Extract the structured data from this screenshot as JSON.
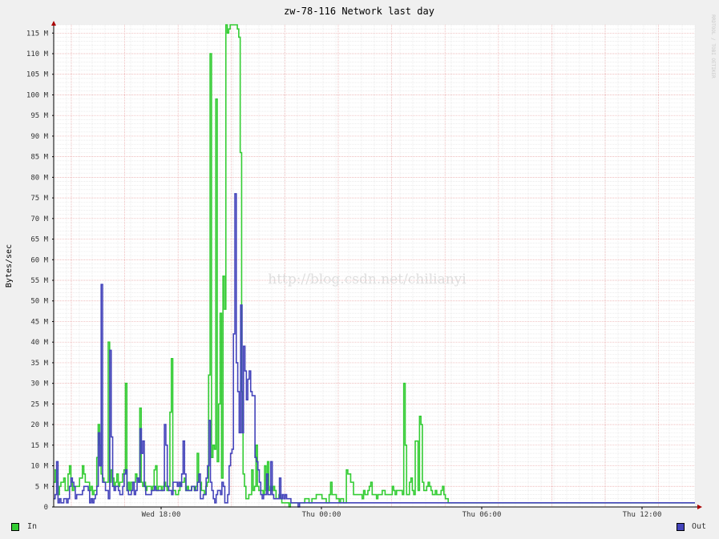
{
  "chart_data": {
    "type": "line",
    "title": "zw-78-116 Network last day",
    "ylabel": "Bytes/sec",
    "watermark": "http://blog.csdn.net/chilianyi",
    "vertical_label": "RRDTOOL / TOBI OETIKER",
    "ylim": [
      0,
      117
    ],
    "grid": true,
    "y_ticks": [
      {
        "value": 0,
        "label": "0"
      },
      {
        "value": 5,
        "label": "5 M"
      },
      {
        "value": 10,
        "label": "10 M"
      },
      {
        "value": 15,
        "label": "15 M"
      },
      {
        "value": 20,
        "label": "20 M"
      },
      {
        "value": 25,
        "label": "25 M"
      },
      {
        "value": 30,
        "label": "30 M"
      },
      {
        "value": 35,
        "label": "35 M"
      },
      {
        "value": 40,
        "label": "40 M"
      },
      {
        "value": 45,
        "label": "45 M"
      },
      {
        "value": 50,
        "label": "50 M"
      },
      {
        "value": 55,
        "label": "55 M"
      },
      {
        "value": 60,
        "label": "60 M"
      },
      {
        "value": 65,
        "label": "65 M"
      },
      {
        "value": 70,
        "label": "70 M"
      },
      {
        "value": 75,
        "label": "75 M"
      },
      {
        "value": 80,
        "label": "80 M"
      },
      {
        "value": 85,
        "label": "85 M"
      },
      {
        "value": 90,
        "label": "90 M"
      },
      {
        "value": 95,
        "label": "95 M"
      },
      {
        "value": 100,
        "label": "100 M"
      },
      {
        "value": 105,
        "label": "105 M"
      },
      {
        "value": 110,
        "label": "110 M"
      },
      {
        "value": 115,
        "label": "115 M"
      }
    ],
    "x_ticks": [
      {
        "x": 67,
        "label": "Wed 18:00"
      },
      {
        "x": 167,
        "label": "Thu 00:00"
      },
      {
        "x": 267,
        "label": "Thu 06:00"
      },
      {
        "x": 367,
        "label": "Thu 12:00"
      }
    ],
    "x_range": [
      0,
      400
    ],
    "series": [
      {
        "name": "In",
        "color": "#33cc33",
        "values": [
          6,
          9,
          6,
          3,
          5,
          6,
          6,
          7,
          4,
          4,
          8,
          10,
          6,
          4,
          5,
          5,
          5,
          5,
          7,
          7,
          10,
          8,
          6,
          6,
          6,
          4,
          5,
          3,
          4,
          4,
          12,
          20,
          15,
          8,
          7,
          6,
          6,
          6,
          40,
          6,
          9,
          7,
          5,
          6,
          8,
          5,
          6,
          6,
          8,
          9,
          30,
          4,
          6,
          4,
          6,
          6,
          6,
          8,
          7,
          6,
          24,
          6,
          5,
          6,
          4,
          5,
          5,
          5,
          4,
          5,
          9,
          10,
          4,
          5,
          5,
          4,
          5,
          6,
          5,
          4,
          5,
          23,
          36,
          4,
          4,
          3,
          3,
          4,
          5,
          6,
          6,
          7,
          4,
          5,
          4,
          4,
          5,
          5,
          4,
          5,
          13,
          6,
          6,
          4,
          4,
          3,
          5,
          6,
          32,
          110,
          12,
          15,
          14,
          99,
          11,
          25,
          47,
          7,
          56,
          48,
          117,
          115,
          116,
          117,
          117,
          117,
          117,
          117,
          116,
          114,
          86,
          28,
          8,
          5,
          2,
          2,
          3,
          3,
          9,
          4,
          5,
          15,
          5,
          4,
          4,
          4,
          3,
          10,
          4,
          11,
          4,
          5,
          4,
          5,
          4,
          2,
          2,
          3,
          2,
          1,
          1,
          1,
          1,
          1,
          0,
          1,
          1,
          1,
          1,
          1,
          1,
          1,
          1,
          1,
          1,
          2,
          2,
          2,
          1,
          1,
          2,
          2,
          2,
          3,
          3,
          3,
          3,
          2,
          2,
          2,
          1,
          1,
          3,
          6,
          3,
          3,
          3,
          2,
          2,
          1,
          2,
          2,
          1,
          1,
          9,
          8,
          8,
          6,
          6,
          3,
          3,
          3,
          3,
          3,
          3,
          2,
          4,
          3,
          3,
          4,
          5,
          6,
          3,
          3,
          3,
          2,
          3,
          3,
          3,
          4,
          4,
          3,
          3,
          3,
          3,
          3,
          5,
          4,
          3,
          4,
          4,
          4,
          4,
          3,
          30,
          15,
          3,
          3,
          6,
          7,
          4,
          3,
          16,
          16,
          4,
          22,
          20,
          6,
          4,
          4,
          5,
          6,
          5,
          4,
          3,
          3,
          4,
          3,
          3,
          3,
          4,
          5,
          3,
          2,
          2,
          1,
          1,
          1,
          1,
          1,
          1,
          1,
          1,
          1,
          1,
          1,
          1,
          1,
          1,
          1,
          1,
          1,
          1,
          1,
          1,
          1,
          1,
          1,
          1,
          1,
          1,
          1,
          1,
          1,
          1,
          1,
          1,
          1,
          1,
          1,
          1,
          1,
          1,
          1,
          1,
          1,
          1,
          1,
          1,
          1,
          1,
          1,
          1,
          1,
          1,
          1,
          1,
          1,
          1,
          1,
          1,
          1,
          1,
          1,
          1,
          1,
          1,
          1,
          1,
          1,
          1,
          1,
          1,
          1,
          1,
          1,
          1,
          1,
          1,
          1,
          1,
          1,
          1,
          1,
          1,
          1,
          1,
          1,
          1,
          1,
          1,
          1,
          1,
          1,
          1,
          1,
          1,
          1,
          1,
          1,
          1,
          1,
          1,
          1,
          1,
          1,
          1,
          1,
          1,
          1,
          1,
          1,
          1,
          1,
          1,
          1,
          1,
          1,
          1,
          1,
          1,
          1,
          1,
          1,
          1,
          1,
          1,
          1,
          1,
          1,
          1,
          1,
          1,
          1,
          1,
          1,
          1,
          1,
          1,
          1,
          1,
          1,
          1,
          1,
          1,
          1,
          1,
          1,
          1,
          1,
          1,
          1,
          1,
          1,
          1,
          1,
          1,
          1,
          1,
          1,
          1,
          1,
          1,
          1,
          1,
          1,
          1,
          1,
          1,
          1,
          1,
          1,
          1,
          1,
          1,
          1,
          1
        ]
      },
      {
        "name": "Out",
        "color": "#4444bb",
        "values": [
          2,
          3,
          11,
          1,
          2,
          1,
          1,
          2,
          2,
          1,
          2,
          5,
          7,
          6,
          5,
          2,
          3,
          3,
          3,
          3,
          4,
          5,
          5,
          5,
          4,
          1,
          2,
          1,
          2,
          3,
          5,
          18,
          10,
          54,
          6,
          6,
          4,
          4,
          2,
          38,
          17,
          5,
          4,
          5,
          5,
          4,
          3,
          3,
          5,
          8,
          9,
          4,
          3,
          3,
          4,
          6,
          3,
          4,
          7,
          6,
          19,
          13,
          16,
          5,
          3,
          3,
          3,
          3,
          4,
          4,
          5,
          4,
          4,
          4,
          4,
          4,
          4,
          20,
          15,
          5,
          4,
          4,
          3,
          6,
          6,
          6,
          5,
          6,
          5,
          8,
          16,
          8,
          4,
          4,
          4,
          4,
          5,
          5,
          4,
          4,
          6,
          8,
          2,
          2,
          3,
          3,
          7,
          10,
          21,
          6,
          4,
          2,
          1,
          3,
          4,
          4,
          3,
          6,
          5,
          1,
          1,
          3,
          10,
          13,
          14,
          42,
          76,
          35,
          28,
          18,
          49,
          18,
          39,
          33,
          26,
          31,
          33,
          28,
          27,
          27,
          12,
          11,
          9,
          6,
          3,
          2,
          3,
          3,
          8,
          3,
          3,
          11,
          3,
          2,
          2,
          2,
          2,
          7,
          2,
          3,
          2,
          3,
          2,
          2,
          2,
          1,
          1,
          1,
          1,
          1,
          0,
          1,
          1,
          1,
          1,
          1,
          1,
          1,
          1,
          1,
          1,
          1,
          1,
          1,
          1,
          1,
          1,
          1,
          1,
          1,
          1,
          1,
          1,
          1,
          1,
          1,
          1,
          1,
          1,
          1,
          1,
          1,
          1,
          1,
          1,
          1,
          1,
          1,
          1,
          1,
          1,
          1,
          1,
          1,
          1,
          1,
          1,
          1,
          1,
          1,
          1,
          1,
          1,
          1,
          1,
          1,
          1,
          1,
          1,
          1,
          1,
          1,
          1,
          1,
          1,
          1,
          1,
          1,
          1,
          1,
          1,
          1,
          1,
          1,
          1,
          1,
          1,
          1,
          1,
          1,
          1,
          1,
          1,
          1,
          1,
          1,
          1,
          1,
          1,
          1,
          1,
          1,
          1,
          1,
          1,
          1,
          1,
          1,
          1,
          1,
          1,
          1,
          1,
          1,
          1,
          1,
          1,
          1,
          1,
          1,
          1,
          1,
          1,
          1,
          1,
          1,
          1,
          1,
          1,
          1,
          1,
          1,
          1,
          1,
          1,
          1,
          1,
          1,
          1,
          1,
          1,
          1,
          1,
          1,
          1,
          1,
          1,
          1,
          1,
          1,
          1,
          1,
          1,
          1,
          1,
          1,
          1,
          1,
          1,
          1,
          1,
          1,
          1,
          1,
          1,
          1,
          1,
          1,
          1,
          1,
          1,
          1,
          1,
          1,
          1,
          1,
          1,
          1,
          1,
          1,
          1,
          1,
          1,
          1,
          1,
          1,
          1,
          1,
          1,
          1,
          1,
          1,
          1,
          1,
          1,
          1,
          1,
          1,
          1,
          1,
          1,
          1,
          1,
          1,
          1,
          1,
          1,
          1,
          1,
          1,
          1,
          1,
          1,
          1,
          1,
          1,
          1,
          1,
          1,
          1,
          1,
          1,
          1,
          1,
          1,
          1,
          1,
          1,
          1,
          1,
          1,
          1,
          1,
          1,
          1,
          1,
          1,
          1,
          1,
          1,
          1,
          1,
          1,
          1,
          1,
          1,
          1,
          1,
          1,
          1,
          1,
          1,
          1,
          1,
          1,
          1,
          1,
          1,
          1,
          1,
          1,
          1,
          1,
          1,
          1,
          1,
          1,
          1,
          1,
          1,
          1,
          1,
          1,
          1,
          1,
          1,
          1,
          1,
          1,
          1,
          1,
          1,
          1,
          1,
          1,
          1
        ]
      }
    ]
  },
  "legend": {
    "in_label": "In",
    "out_label": "Out",
    "in_color": "#33cc33",
    "out_color": "#4444bb"
  }
}
